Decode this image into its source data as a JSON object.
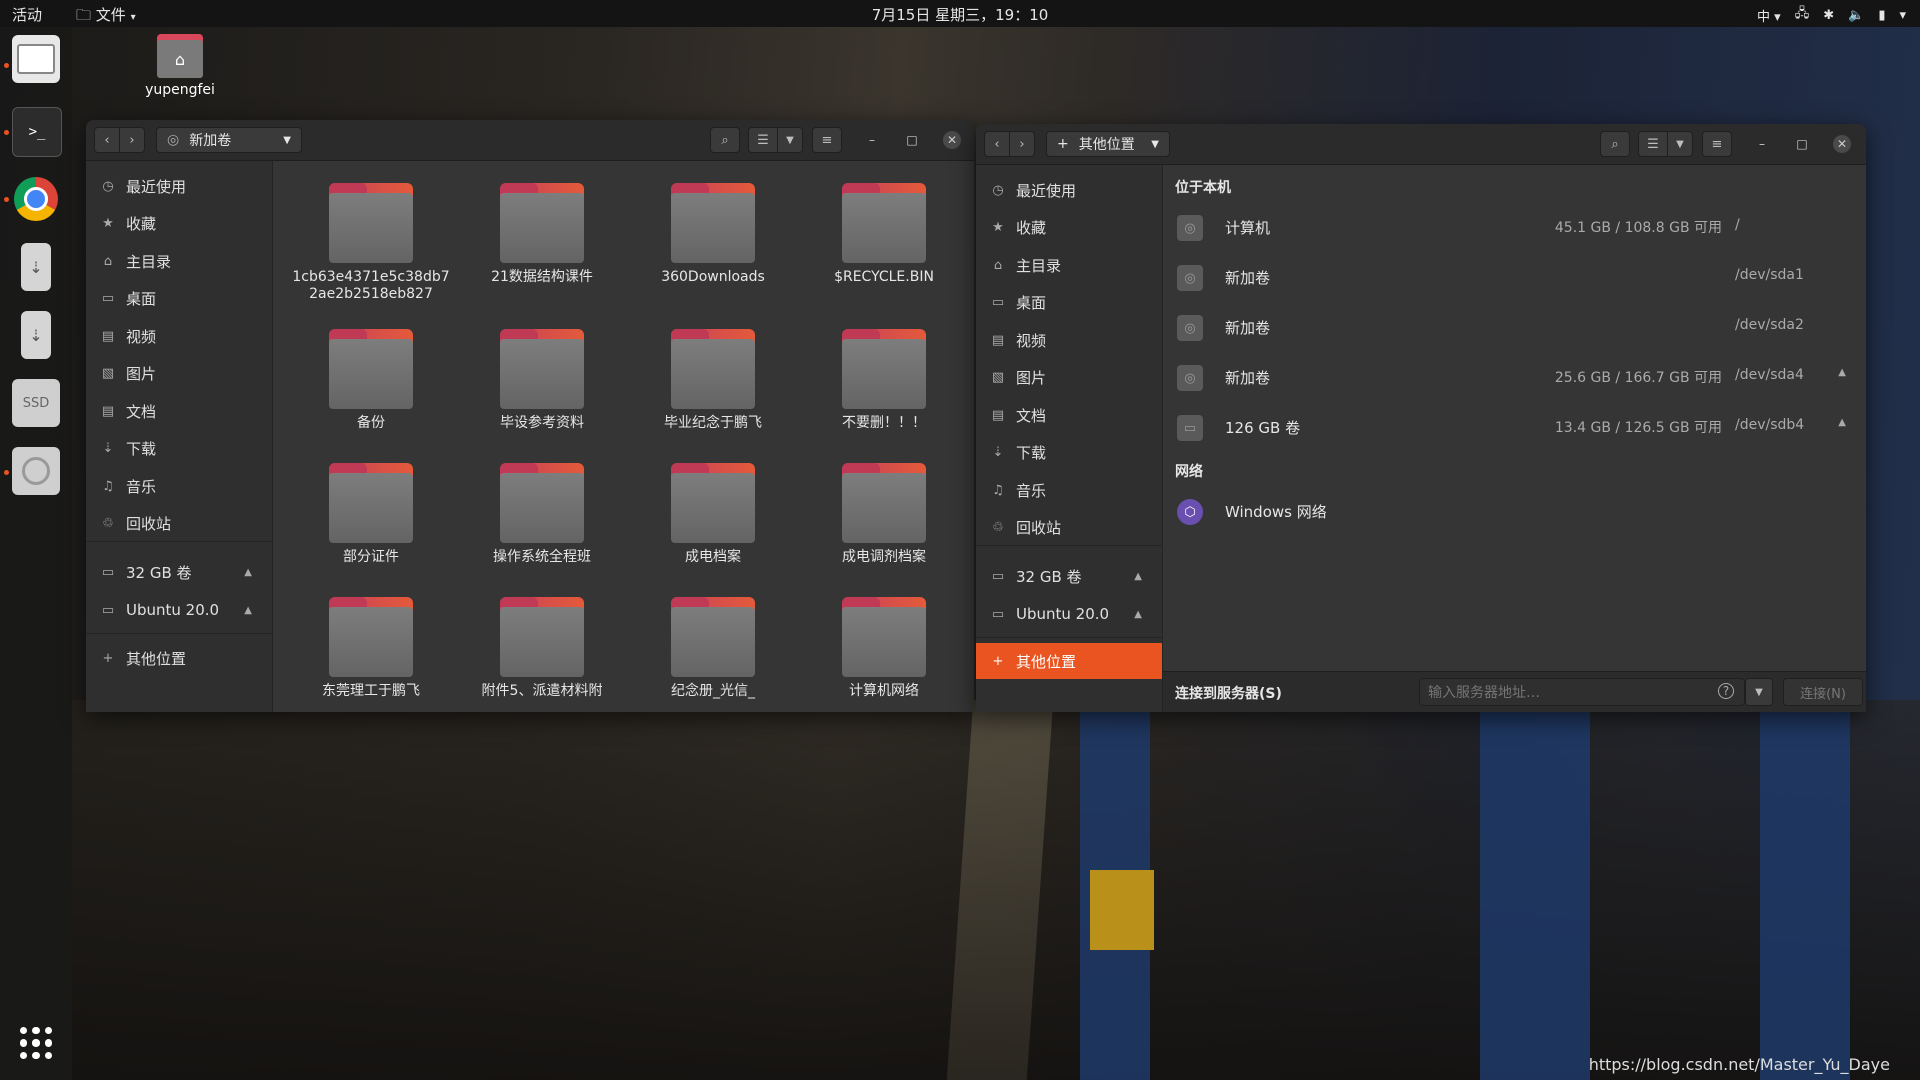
{
  "topbar": {
    "activities": "活动",
    "app_menu": "文件",
    "clock": "7月15日 星期三，19：10",
    "input_method": "中"
  },
  "desktop": {
    "home_icon_label": "yupengfei"
  },
  "dock": {
    "items": [
      "files-icon",
      "terminal-icon",
      "chrome-icon",
      "usb-drive-icon",
      "usb-drive-icon",
      "ssd-icon",
      "optical-drive-icon"
    ],
    "ssd_label": "SSD",
    "apps_grid": "show-applications-icon"
  },
  "left_window": {
    "path_label": "新加卷",
    "sidebar": [
      {
        "label": "最近使用",
        "icon": "clock-icon"
      },
      {
        "label": "收藏",
        "icon": "star-icon"
      },
      {
        "label": "主目录",
        "icon": "home-icon"
      },
      {
        "label": "桌面",
        "icon": "desktop-icon"
      },
      {
        "label": "视频",
        "icon": "video-icon"
      },
      {
        "label": "图片",
        "icon": "image-icon"
      },
      {
        "label": "文档",
        "icon": "document-icon"
      },
      {
        "label": "下载",
        "icon": "download-icon"
      },
      {
        "label": "音乐",
        "icon": "music-icon"
      },
      {
        "label": "回收站",
        "icon": "trash-icon"
      }
    ],
    "devices": [
      "32 GB 卷",
      "Ubuntu 20.0"
    ],
    "other_locations": "其他位置",
    "folders": [
      "1cb63e4371e5c38db72ae2b2518eb827",
      "21数据结构课件",
      "360Downloads",
      "$RECYCLE.BIN",
      "备份",
      "毕设参考资料",
      "毕业纪念于鹏飞",
      "不要删！！！",
      "部分证件",
      "操作系统全程班",
      "成电档案",
      "成电调剂档案",
      "东莞理工于鹏飞",
      "附件5、派遣材料附",
      "纪念册_光信_",
      "计算机网络"
    ]
  },
  "right_window": {
    "path_label": "其他位置",
    "sidebar": [
      {
        "label": "最近使用",
        "icon": "clock-icon"
      },
      {
        "label": "收藏",
        "icon": "star-icon"
      },
      {
        "label": "主目录",
        "icon": "home-icon"
      },
      {
        "label": "桌面",
        "icon": "desktop-icon"
      },
      {
        "label": "视频",
        "icon": "video-icon"
      },
      {
        "label": "图片",
        "icon": "image-icon"
      },
      {
        "label": "文档",
        "icon": "document-icon"
      },
      {
        "label": "下载",
        "icon": "download-icon"
      },
      {
        "label": "音乐",
        "icon": "music-icon"
      },
      {
        "label": "回收站",
        "icon": "trash-icon"
      }
    ],
    "devices": [
      "32 GB 卷",
      "Ubuntu 20.0"
    ],
    "other_locations": "其他位置",
    "section_local": "位于本机",
    "drives": [
      {
        "name": "计算机",
        "usage": "45.1 GB / 108.8 GB 可用",
        "mount": "/",
        "eject": false
      },
      {
        "name": "新加卷",
        "usage": "",
        "mount": "/dev/sda1",
        "eject": false
      },
      {
        "name": "新加卷",
        "usage": "",
        "mount": "/dev/sda2",
        "eject": false
      },
      {
        "name": "新加卷",
        "usage": "25.6 GB / 166.7 GB 可用",
        "mount": "/dev/sda4",
        "eject": true
      },
      {
        "name": "126 GB 卷",
        "usage": "13.4 GB / 126.5 GB 可用",
        "mount": "/dev/sdb4",
        "eject": true
      }
    ],
    "section_network": "网络",
    "network_item": "Windows 网络",
    "connect_label": "连接到服务器(S)",
    "server_placeholder": "输入服务器地址…",
    "connect_button": "连接(N)"
  },
  "watermark": "https://blog.csdn.net/Master_Yu_Daye",
  "colors": {
    "accent": "#e95420",
    "folder_tab": "#d9485a"
  }
}
